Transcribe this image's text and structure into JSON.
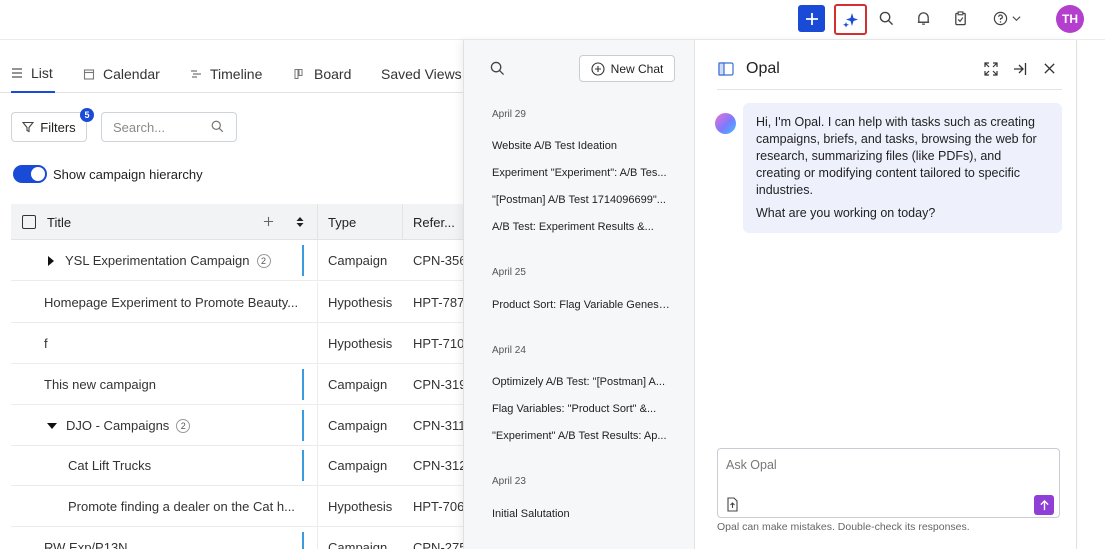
{
  "topbar": {
    "avatar_initials": "TH",
    "icons": [
      "plus-icon",
      "sparkle-icon",
      "search-icon",
      "bell-icon",
      "clipboard-icon",
      "help-icon",
      "chevron-down-icon"
    ],
    "accent": "#1a4bd6",
    "highlight": "#d32f2f"
  },
  "tabs": [
    {
      "label": "List",
      "icon": "list-icon",
      "active": true
    },
    {
      "label": "Calendar",
      "icon": "calendar-icon"
    },
    {
      "label": "Timeline",
      "icon": "timeline-icon"
    },
    {
      "label": "Board",
      "icon": "board-icon"
    },
    {
      "label": "Saved Views"
    }
  ],
  "toolbar": {
    "filters_label": "Filters",
    "filters_count": "5",
    "search_placeholder": "Search...",
    "hierarchy_label": "Show campaign hierarchy"
  },
  "table": {
    "headers": {
      "title": "Title",
      "type": "Type",
      "reference": "Refer..."
    },
    "rows": [
      {
        "title": "YSL Experimentation Campaign",
        "count": "2",
        "type": "Campaign",
        "ref": "CPN-356",
        "caret": "right",
        "indent": 1
      },
      {
        "title": "Homepage Experiment to Promote Beauty...",
        "type": "Hypothesis",
        "ref": "HPT-787",
        "indent": 0
      },
      {
        "title": "f",
        "type": "Hypothesis",
        "ref": "HPT-710",
        "indent": 0
      },
      {
        "title": "This new campaign",
        "type": "Campaign",
        "ref": "CPN-319",
        "indent": 0
      },
      {
        "title": "DJO - Campaigns",
        "count": "2",
        "type": "Campaign",
        "ref": "CPN-311",
        "caret": "down",
        "indent": 1
      },
      {
        "title": "Cat Lift Trucks",
        "type": "Campaign",
        "ref": "CPN-312",
        "indent": 2
      },
      {
        "title": "Promote finding a dealer on the Cat h...",
        "type": "Hypothesis",
        "ref": "HPT-706",
        "indent": 2
      },
      {
        "title": "RW Exp/P13N",
        "type": "Campaign",
        "ref": "CPN-275",
        "indent": 0
      }
    ]
  },
  "history": {
    "new_chat_label": "New Chat",
    "groups": [
      {
        "date": "April 29",
        "items": [
          "Website A/B Test Ideation",
          "Experiment \"Experiment\": A/B Tes...",
          "\"[Postman] A/B Test 1714096699\"...",
          "A/B Test: Experiment Results &..."
        ]
      },
      {
        "date": "April 25",
        "items": [
          "Product Sort: Flag Variable Genesi..."
        ]
      },
      {
        "date": "April 24",
        "items": [
          "Optimizely A/B Test: \"[Postman] A...",
          "Flag Variables: \"Product Sort\" &...",
          "\"Experiment\" A/B Test Results: Ap..."
        ]
      },
      {
        "date": "April 23",
        "items": [
          "Initial Salutation"
        ]
      }
    ]
  },
  "chat": {
    "title": "Opal",
    "greeting": "Hi, I'm Opal. I can help with tasks such as creating campaigns, briefs, and tasks, browsing the web for research, summarizing files (like PDFs), and creating or modifying content tailored to specific industries.",
    "question": "What are you working on today?",
    "input_placeholder": "Ask Opal",
    "disclaimer": "Opal can make mistakes. Double-check its responses."
  }
}
